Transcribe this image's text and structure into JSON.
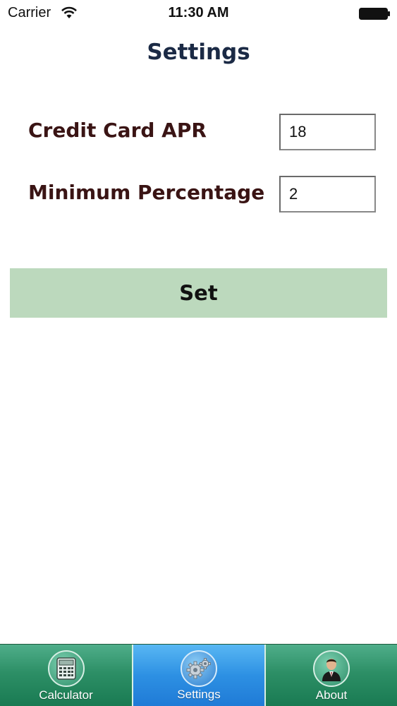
{
  "status_bar": {
    "carrier": "Carrier",
    "time": "11:30 AM",
    "wifi_icon": "wifi-icon",
    "battery_icon": "battery-icon"
  },
  "header": {
    "title": "Settings"
  },
  "form": {
    "credit_card_apr": {
      "label": "Credit Card APR",
      "value": "18"
    },
    "minimum_percentage": {
      "label": "Minimum Percentage",
      "value": "2"
    },
    "set_button_label": "Set"
  },
  "tab_bar": {
    "tabs": [
      {
        "label": "Calculator",
        "icon": "calculator-icon",
        "selected": false
      },
      {
        "label": "Settings",
        "icon": "gears-icon",
        "selected": true
      },
      {
        "label": "About",
        "icon": "person-icon",
        "selected": false
      }
    ]
  },
  "colors": {
    "title": "#1b2a45",
    "label": "#3a1414",
    "set_button_bg": "#bcd9bd",
    "tab_bar_green": "#2d8f66",
    "tab_selected_blue": "#2d90e3"
  }
}
